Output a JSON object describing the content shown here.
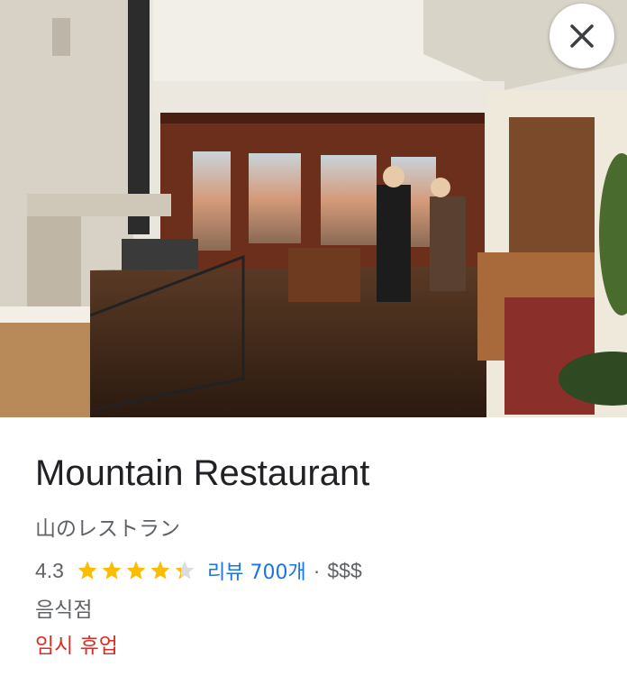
{
  "place": {
    "name": "Mountain Restaurant",
    "native_name": "山のレストラン",
    "rating": "4.3",
    "rating_value": 4.3,
    "stars_max": 5,
    "reviews_label": "리뷰 700개",
    "separator": "·",
    "price_level": "$$$",
    "category": "음식점",
    "status": "임시 휴업"
  },
  "photo": {
    "subject": "restaurant-interior-photo"
  },
  "controls": {
    "close_icon": "close-icon"
  },
  "colors": {
    "title": "#202124",
    "secondary_text": "#5f6368",
    "link": "#1a73e8",
    "star": "#fbbc04",
    "star_empty": "#dadce0",
    "status": "#d93025"
  }
}
